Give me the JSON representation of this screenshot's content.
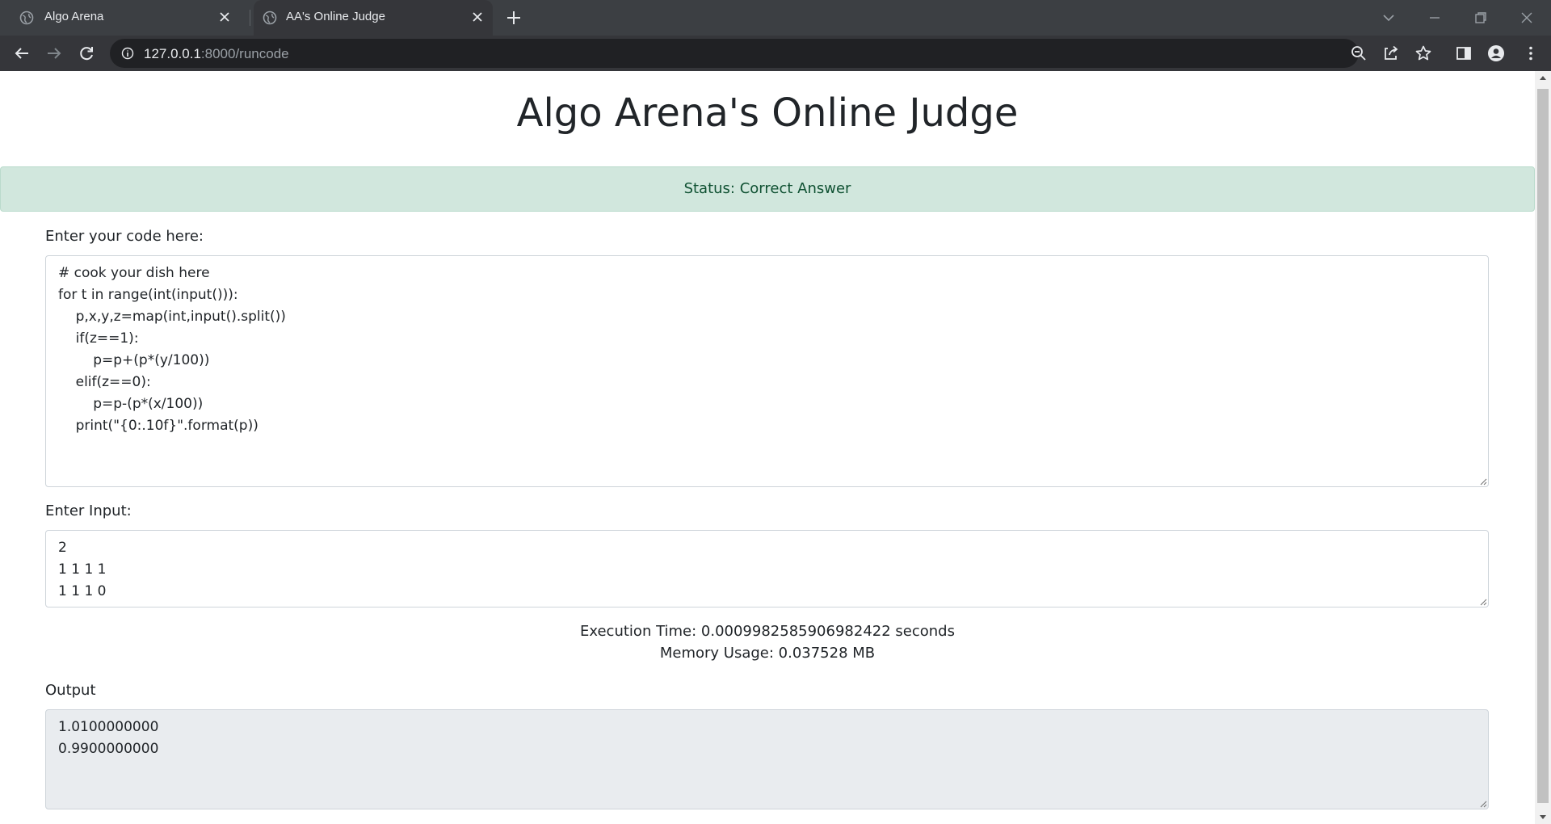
{
  "browser": {
    "tabs": [
      {
        "title": "Algo Arena",
        "active": false
      },
      {
        "title": "AA's Online Judge",
        "active": true
      }
    ],
    "url_host": "127.0.0.1",
    "url_rest": ":8000/runcode"
  },
  "page": {
    "title": "Algo Arena's Online Judge",
    "status": "Status: Correct Answer",
    "code_label": "Enter your code here:",
    "code": "# cook your dish here\nfor t in range(int(input())):\n    p,x,y,z=map(int,input().split())\n    if(z==1):\n        p=p+(p*(y/100))\n    elif(z==0):\n        p=p-(p*(x/100))\n    print(\"{0:.10f}\".format(p))",
    "input_label": "Enter Input:",
    "input": "2\n1 1 1 1\n1 1 1 0",
    "execution_time": "Execution Time: 0.0009982585906982422 seconds",
    "memory_usage": "Memory Usage: 0.037528 MB",
    "output_label": "Output",
    "output": "1.0100000000\n0.9900000000"
  },
  "colors": {
    "status_bg": "#d1e7dd",
    "status_text": "#0f5132",
    "readonly_bg": "#e9ecef"
  }
}
